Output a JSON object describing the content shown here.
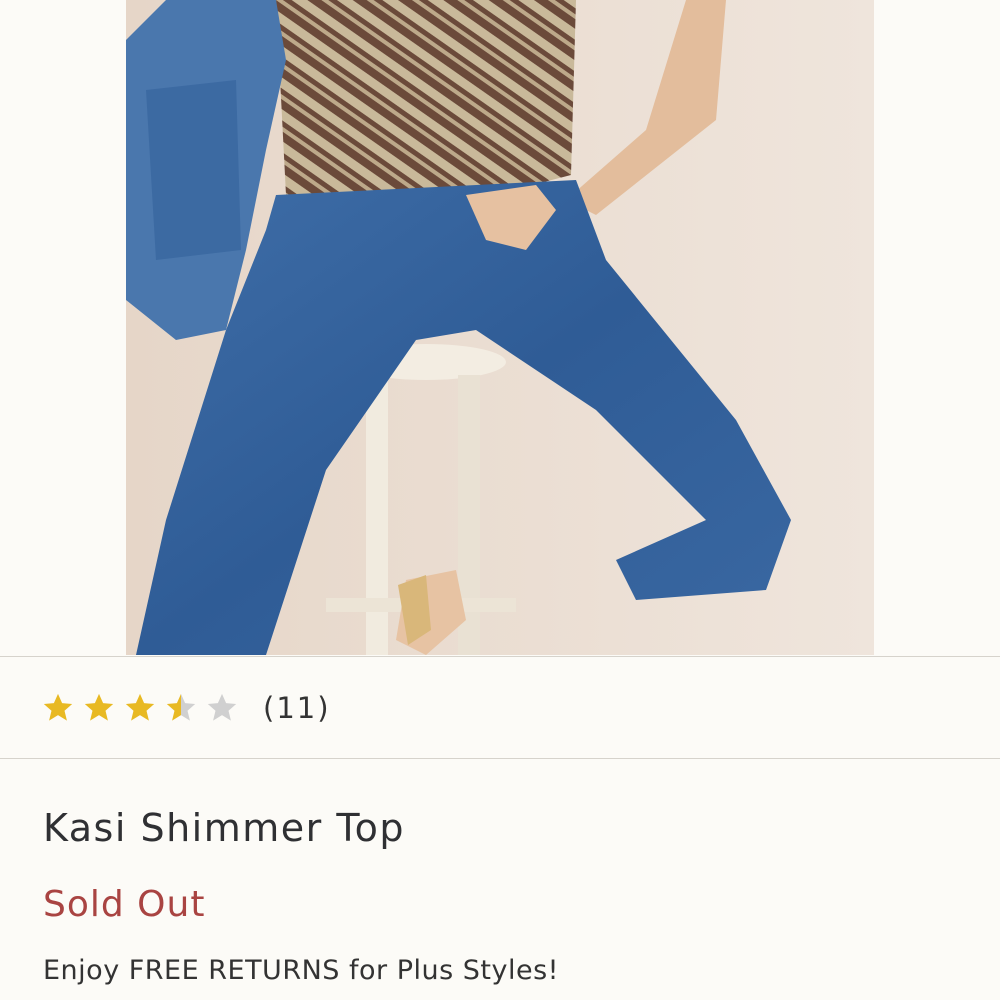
{
  "product": {
    "image_alt": "Model wearing zebra-print shimmer top with blue skinny jeans, seated on a white stool, holding a denim jacket",
    "rating": {
      "value": 3.5,
      "max": 5,
      "count_label": "(11)"
    },
    "title": "Kasi Shimmer Top",
    "status": "Sold Out",
    "promo": "Enjoy FREE RETURNS for Plus Styles!"
  },
  "colors": {
    "star_filled": "#e8b923",
    "star_empty": "#d0d0d0",
    "status": "#a94442",
    "divider": "#d6d3cc"
  },
  "icons": [
    "star-icon",
    "star-icon",
    "star-icon",
    "star-half-icon",
    "star-empty-icon"
  ]
}
